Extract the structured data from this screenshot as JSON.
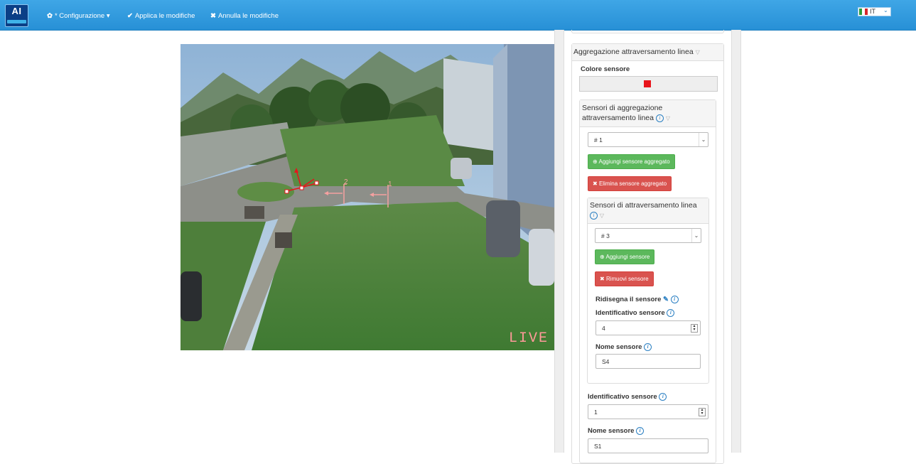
{
  "topbar": {
    "logo_text": "AI",
    "config_label": "* Configurazione",
    "apply_label": "Applica le modifiche",
    "cancel_label": "Annulla le modifiche",
    "language": "IT",
    "flag_colors": [
      "#2b9c3a",
      "#ffffff",
      "#d6262c"
    ]
  },
  "camera": {
    "live_label": "LIVE",
    "line_markers": [
      "1",
      "2"
    ]
  },
  "aggregation_panel": {
    "title": "Aggregazione attraversamento linea",
    "color_label": "Colore sensore",
    "color_value": "#e8141b",
    "aggregate_panel_title": "Sensori di aggregazione attraversamento linea",
    "aggregate_select": "# 1",
    "add_aggregate_label": "Aggiungi sensore aggregato",
    "delete_aggregate_label": "Elimina sensore aggregato",
    "crossing_panel_title": "Sensori di attraversamento linea",
    "crossing_select": "# 3",
    "add_sensor_label": "Aggiungi sensore",
    "remove_sensor_label": "Rimuovi sensore",
    "redraw_label": "Ridisegna il sensore",
    "inner_id_label": "Identificativo sensore",
    "inner_id_value": "4",
    "inner_name_label": "Nome sensore",
    "inner_name_value": "S4",
    "outer_id_label": "Identificativo sensore",
    "outer_id_value": "1",
    "outer_name_label": "Nome sensore",
    "outer_name_value": "S1"
  }
}
